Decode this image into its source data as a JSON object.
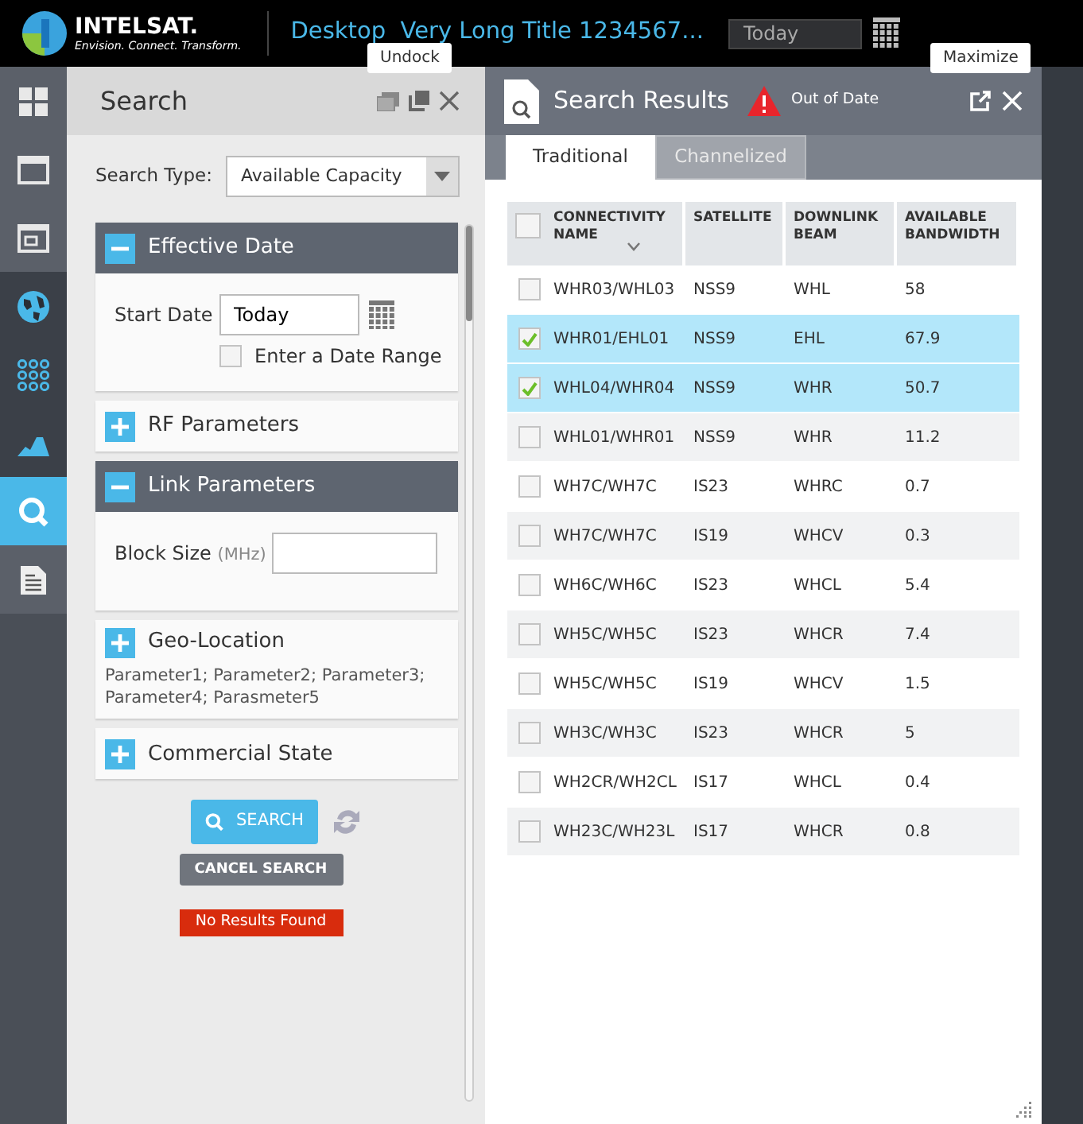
{
  "header": {
    "brand": "INTELSAT.",
    "tagline": "Envision. Connect. Transform.",
    "title": "Desktop  Very Long Title 1234567...",
    "date_value": "Today"
  },
  "rail": [
    {
      "kind": "grid",
      "selected": false
    },
    {
      "kind": "window",
      "selected": false
    },
    {
      "kind": "window-small",
      "selected": false
    },
    {
      "kind": "globe",
      "selected": false
    },
    {
      "kind": "dots",
      "selected": false
    },
    {
      "kind": "mountain",
      "selected": false
    },
    {
      "kind": "search",
      "selected": true
    },
    {
      "kind": "document",
      "selected": false
    }
  ],
  "search_panel": {
    "title": "Search",
    "tooltip": "Undock",
    "search_type_label": "Search Type:",
    "search_type_value": "Available Capacity",
    "sections": [
      {
        "title": "Effective Date",
        "expanded": true,
        "kind": "date",
        "field_label": "Start Date",
        "field_value": "Today",
        "checkbox_label": "Enter a Date Range",
        "checkbox_checked": false
      },
      {
        "title": "RF Parameters",
        "expanded": false
      },
      {
        "title": "Link Parameters",
        "expanded": true,
        "kind": "block",
        "field_label": "Block Size",
        "field_unit": "(MHz)"
      },
      {
        "title": "Geo-Location",
        "expanded": false,
        "summary": "Parameter1; Parameter2; Parameter3; Parameter4; Parasmeter5"
      },
      {
        "title": "Commercial State",
        "expanded": false
      }
    ],
    "search_button": "SEARCH",
    "cancel_button": "CANCEL SEARCH",
    "message": "No Results Found"
  },
  "results_panel": {
    "title": "Search Results",
    "warning": "Out of Date",
    "tooltip": "Maximize",
    "tabs": [
      {
        "label": "Traditional",
        "selected": true
      },
      {
        "label": "Channelized",
        "selected": false
      }
    ],
    "table": {
      "columns": [
        "CONNECTIVITY NAME",
        "SATELLITE",
        "DOWNLINK BEAM",
        "AVAILABLE BANDWIDTH"
      ],
      "all_checked": false,
      "rows": [
        {
          "cells": [
            "WHR03/WHL03",
            "NSS9",
            "WHL",
            "58"
          ],
          "selected": false
        },
        {
          "cells": [
            "WHR01/EHL01",
            "NSS9",
            "EHL",
            "67.9"
          ],
          "selected": true
        },
        {
          "cells": [
            "WHL04/WHR04",
            "NSS9",
            "WHR",
            "50.7"
          ],
          "selected": true
        },
        {
          "cells": [
            "WHL01/WHR01",
            "NSS9",
            "WHR",
            "11.2"
          ],
          "selected": false
        },
        {
          "cells": [
            "WH7C/WH7C",
            "IS23",
            "WHRC",
            "0.7"
          ],
          "selected": false
        },
        {
          "cells": [
            "WH7C/WH7C",
            "IS19",
            "WHCV",
            "0.3"
          ],
          "selected": false
        },
        {
          "cells": [
            "WH6C/WH6C",
            "IS23",
            "WHCL",
            "5.4"
          ],
          "selected": false
        },
        {
          "cells": [
            "WH5C/WH5C",
            "IS23",
            "WHCR",
            "7.4"
          ],
          "selected": false
        },
        {
          "cells": [
            "WH5C/WH5C",
            "IS19",
            "WHCV",
            "1.5"
          ],
          "selected": false
        },
        {
          "cells": [
            "WH3C/WH3C",
            "IS23",
            "WHCR",
            "5"
          ],
          "selected": false
        },
        {
          "cells": [
            "WH2CR/WH2CL",
            "IS17",
            "WHCL",
            "0.4"
          ],
          "selected": false
        },
        {
          "cells": [
            "WH23C/WH23L",
            "IS17",
            "WHCR",
            "0.8"
          ],
          "selected": false
        }
      ]
    }
  }
}
